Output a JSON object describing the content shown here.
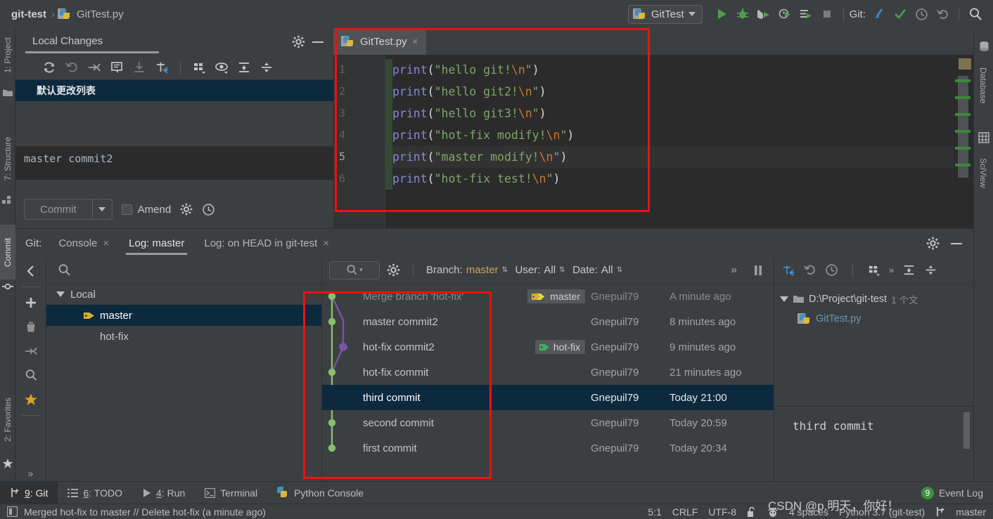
{
  "breadcrumb": {
    "root": "git-test",
    "separator": "›",
    "file": "GitTest.py",
    "file_icon": "python-file-icon"
  },
  "toolbar": {
    "run_config": "GitTest",
    "git_label": "Git:",
    "icons": [
      "run-icon",
      "debug-icon",
      "run-coverage-icon",
      "profile-icon",
      "run-with-console-icon",
      "stop-icon",
      "git-update-icon",
      "git-commit-check-icon",
      "git-history-icon",
      "git-revert-icon",
      "search-everywhere-icon"
    ]
  },
  "left_strip": {
    "tabs": [
      {
        "label": "1: Project",
        "icon": "project-folder-icon",
        "selected": false
      },
      {
        "label": "7: Structure",
        "icon": "structure-icon",
        "selected": false
      },
      {
        "label": "Commit",
        "icon": "commit-icon",
        "selected": true
      },
      {
        "label": "2: Favorites",
        "icon": "star-icon",
        "selected": false
      }
    ]
  },
  "right_strip": {
    "tabs": [
      {
        "label": "Database",
        "icon": "database-icon"
      },
      {
        "label": "SciView",
        "icon": "sciview-grid-icon"
      }
    ]
  },
  "local_changes": {
    "title": "Local Changes",
    "header_icons": [
      "gear-icon",
      "minimize-icon"
    ],
    "toolbar_icons": [
      "refresh-icon",
      "rollback-icon",
      "shelve-silently-icon",
      "comment-icon",
      "unshelve-icon",
      "move-to-changelist-icon",
      "group-by-icon",
      "preview-diff-icon",
      "expand-all-icon",
      "collapse-all-icon"
    ],
    "changelist": "默认更改列表",
    "commit_message": "master commit2",
    "commit_button": "Commit",
    "amend_label": "Amend",
    "amend_checked": false,
    "footer_icons": [
      "gear-icon",
      "history-icon"
    ]
  },
  "editor": {
    "tab": {
      "label": "GitTest.py",
      "icon": "python-file-icon",
      "close": "×"
    },
    "lines": [
      {
        "num": "1",
        "fn": "print",
        "open": "(",
        "str": "\"hello git!",
        "esc": "\\n",
        "str2": "\"",
        "close": ")",
        "current": false
      },
      {
        "num": "2",
        "fn": "print",
        "open": "(",
        "str": "\"hello git2!",
        "esc": "\\n",
        "str2": "\"",
        "close": ")",
        "current": false
      },
      {
        "num": "3",
        "fn": "print",
        "open": "(",
        "str": "\"hello git3!",
        "esc": "\\n",
        "str2": "\"",
        "close": ")",
        "current": false
      },
      {
        "num": "4",
        "fn": "print",
        "open": "(",
        "str": "\"hot-fix modify!",
        "esc": "\\n",
        "str2": "\"",
        "close": ")",
        "current": false
      },
      {
        "num": "5",
        "fn": "print",
        "open": "(",
        "str": "\"master modify!",
        "esc": "\\n",
        "str2": "\"",
        "close": ")",
        "current": true
      },
      {
        "num": "6",
        "fn": "print",
        "open": "(",
        "str": "\"hot-fix test!",
        "esc": "\\n",
        "str2": "\"",
        "close": ")",
        "current": false
      }
    ]
  },
  "git_window": {
    "label": "Git:",
    "tabs": [
      {
        "label": "Console",
        "closable": true,
        "selected": false
      },
      {
        "label": "Log: master",
        "closable": false,
        "selected": true
      },
      {
        "label": "Log: on HEAD in git-test",
        "closable": true,
        "selected": false
      }
    ],
    "actions": [
      "gear-icon",
      "minimize-icon"
    ],
    "mini_bar_icons": [
      "back-arrow-icon",
      "add-icon",
      "delete-icon",
      "collapse-icon",
      "search-icon",
      "star-icon",
      "more-icon"
    ],
    "branches": {
      "search_icon": "search-icon",
      "root": "Local",
      "items": [
        {
          "label": "master",
          "tag": true,
          "selected": true
        },
        {
          "label": "hot-fix",
          "tag": false,
          "selected": false
        }
      ]
    },
    "log_toolbar": {
      "search_placeholder": "",
      "gear": "gear-icon",
      "branch_filter": {
        "label": "Branch:",
        "value": "master"
      },
      "user_filter": {
        "label": "User:",
        "value": "All"
      },
      "date_filter": {
        "label": "Date:",
        "value": "All"
      },
      "overflow": "»",
      "pause": "pause-icon"
    },
    "commits": [
      {
        "message": "Merge branch 'hot-fix'",
        "ref": "master",
        "ref_color": "#d8b030",
        "user": "Gnepuil79",
        "date": "A minute ago",
        "selected": false,
        "dim": true
      },
      {
        "message": "master commit2",
        "ref": "",
        "ref_color": "",
        "user": "Gnepuil79",
        "date": "8 minutes ago",
        "selected": false,
        "dim": false
      },
      {
        "message": "hot-fix commit2",
        "ref": "hot-fix",
        "ref_color": "#3fae5f",
        "user": "Gnepuil79",
        "date": "9 minutes ago",
        "selected": false,
        "dim": false
      },
      {
        "message": "hot-fix commit",
        "ref": "",
        "ref_color": "",
        "user": "Gnepuil79",
        "date": "21 minutes ago",
        "selected": false,
        "dim": false
      },
      {
        "message": "third commit",
        "ref": "",
        "ref_color": "",
        "user": "Gnepuil79",
        "date": "Today 21:00",
        "selected": true,
        "dim": false
      },
      {
        "message": "second commit",
        "ref": "",
        "ref_color": "",
        "user": "Gnepuil79",
        "date": "Today 20:59",
        "selected": false,
        "dim": false
      },
      {
        "message": "first commit",
        "ref": "",
        "ref_color": "",
        "user": "Gnepuil79",
        "date": "Today 20:34",
        "selected": false,
        "dim": false
      }
    ],
    "right_toolbar_icons": [
      "diff-icon",
      "revert-icon",
      "history-icon",
      "group-by-icon",
      "more-icon",
      "expand-all-icon",
      "collapse-all-icon"
    ],
    "details": {
      "path": "D:\\Project\\git-test",
      "count": "1 个文",
      "file": "GitTest.py",
      "message": "third commit"
    }
  },
  "bottom_tools": [
    {
      "num": "9",
      "label": "Git",
      "icon": "git-branch-icon",
      "selected": true
    },
    {
      "num": "6",
      "label": "TODO",
      "icon": "todo-list-icon",
      "selected": false
    },
    {
      "num": "4",
      "label": "Run",
      "icon": "run-icon",
      "selected": false
    },
    {
      "num": "",
      "label": "Terminal",
      "icon": "terminal-icon",
      "selected": false
    },
    {
      "num": "",
      "label": "Python Console",
      "icon": "python-icon",
      "selected": false
    }
  ],
  "event_log": {
    "count": "9",
    "label": "Event Log"
  },
  "status_bar": {
    "message": "Merged hot-fix to master // Delete hot-fix (a minute ago)",
    "message_icon": "info-icon",
    "caret": "5:1",
    "line_sep": "CRLF",
    "encoding": "UTF-8",
    "lock_icon": "unlocked-icon",
    "inspection_icon": "hector-icon",
    "indent": "4 spaces",
    "interpreter": "Python 3.7 (git-test)",
    "branch_icon": "git-branch-icon",
    "branch": "master"
  },
  "watermark": "CSDN @p.明天，你好！",
  "colors": {
    "background": "#3c3f41",
    "editor_background": "#2b2b2b",
    "selection": "#0d293e",
    "graph_green": "#8bbf6a",
    "graph_purple": "#7b52ae",
    "annotation_red": "#ee1111",
    "accent_blue": "#4a90d9"
  }
}
